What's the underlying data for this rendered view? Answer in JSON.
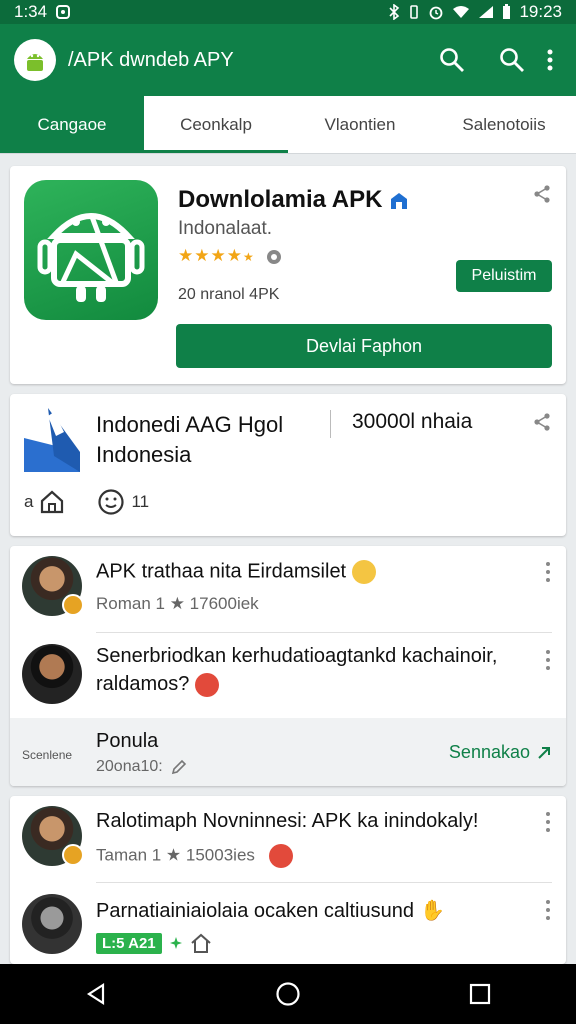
{
  "status_bar": {
    "time_left": "1:34",
    "time_right": "19:23"
  },
  "app_bar": {
    "title": "/APK dwndeb APY",
    "icons": [
      "android-logo-icon",
      "search-icon",
      "search-icon",
      "more-vert-icon"
    ]
  },
  "tabs": [
    {
      "label": "Cangaoe",
      "active": true
    },
    {
      "label": "Ceonkalp",
      "active": false
    },
    {
      "label": "Vlaontien",
      "active": false
    },
    {
      "label": "Salenotoiis",
      "active": false
    }
  ],
  "featured": {
    "name": "Downlolamia APK",
    "developer": "Indonalaat.",
    "stars": "★★★★",
    "rating_value": 4.5,
    "size": "20 nranol 4PK",
    "small_button": "Peluistim",
    "main_button": "Devlai Faphon"
  },
  "second_card": {
    "title": "Indonedi AAG Hgol Indonesia",
    "count": "30000l nhaia",
    "footer_letter": "a",
    "footer_count": "11"
  },
  "list_one": [
    {
      "title": "APK trathaa nita Eirdamsilet",
      "sub": "Roman 1 ★ 17600iek"
    },
    {
      "title": "Senerbriodkan kerhudatioagtankd kachainoir, raldamos?",
      "sub": ""
    }
  ],
  "list_one_footer": {
    "label": "Scenlene",
    "title": "Ponula",
    "sub": "20ona10:",
    "link": "Sennakao"
  },
  "list_two": [
    {
      "title": "Ralotimaph Novninnesi: APK ka inindokaly!",
      "sub": "Taman 1 ★ 15003ies"
    },
    {
      "title": "Parnatiainiaiolaia ocaken caltiusund",
      "tag": "L:5 A21"
    }
  ],
  "colors": {
    "brand": "#0f8048",
    "status_bar": "#0c6b3b",
    "star": "#f2a516",
    "tag": "#2bb24c"
  }
}
